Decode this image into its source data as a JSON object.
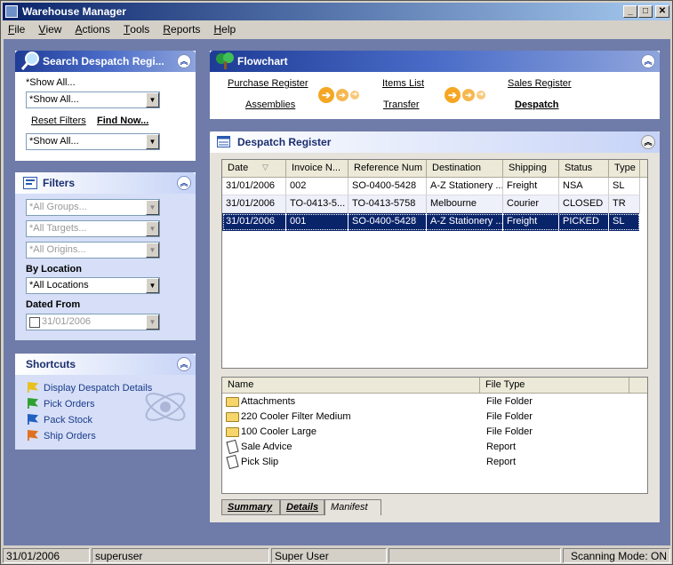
{
  "window": {
    "title": "Warehouse Manager"
  },
  "menu": [
    {
      "label": "File",
      "mnemonic": "F",
      "rest": "ile"
    },
    {
      "label": "View",
      "mnemonic": "V",
      "rest": "iew"
    },
    {
      "label": "Actions",
      "mnemonic": "A",
      "rest": "ctions"
    },
    {
      "label": "Tools",
      "mnemonic": "T",
      "rest": "ools"
    },
    {
      "label": "Reports",
      "mnemonic": "R",
      "rest": "eports"
    },
    {
      "label": "Help",
      "mnemonic": "H",
      "rest": "elp"
    }
  ],
  "search_panel": {
    "title": "Search Despatch Regi...",
    "heading": "*Show All...",
    "combo1": "*Show All...",
    "reset_label": "Reset Filters",
    "find_label": "Find Now...",
    "combo2": "*Show All..."
  },
  "filters_panel": {
    "title": "Filters",
    "groups": "*All Groups...",
    "targets": "*All Targets...",
    "origins": "*All Origins...",
    "by_location_label": "By Location",
    "location": "*All Locations",
    "dated_from_label": "Dated From",
    "dated_from": "31/01/2006"
  },
  "shortcuts_panel": {
    "title": "Shortcuts",
    "items": [
      {
        "label": "Display Despatch Details",
        "color": "#e8c020"
      },
      {
        "label": "Pick Orders",
        "color": "#30a030"
      },
      {
        "label": "Pack Stock",
        "color": "#2060c0"
      },
      {
        "label": "Ship Orders",
        "color": "#e07020"
      }
    ]
  },
  "flowchart": {
    "title": "Flowchart",
    "purchase_register": "Purchase Register",
    "assemblies": "Assemblies",
    "items_list": "Items List",
    "transfer": "Transfer",
    "sales_register": "Sales Register",
    "despatch": "Despatch"
  },
  "register": {
    "title": "Despatch Register",
    "columns": [
      "Date",
      "Invoice N...",
      "Reference Num",
      "Destination",
      "Shipping",
      "Status",
      "Type"
    ],
    "rows": [
      [
        "31/01/2006",
        "002",
        "SO-0400-5428",
        "A-Z Stationery ...",
        "Freight",
        "NSA",
        "SL"
      ],
      [
        "31/01/2006",
        "TO-0413-5...",
        "TO-0413-5758",
        "Melbourne",
        "Courier",
        "CLOSED",
        "TR"
      ],
      [
        "31/01/2006",
        "001",
        "SO-0400-5428",
        "A-Z Stationery ...",
        "Freight",
        "PICKED",
        "SL"
      ]
    ],
    "selected_row": 2
  },
  "files": {
    "columns": [
      "Name",
      "File Type"
    ],
    "rows": [
      {
        "name": "Attachments",
        "type": "File Folder",
        "icon": "folder-icon"
      },
      {
        "name": "220 Cooler Filter Medium",
        "type": "File Folder",
        "icon": "folder-icon"
      },
      {
        "name": "100 Cooler Large",
        "type": "File Folder",
        "icon": "folder-icon"
      },
      {
        "name": "Sale Advice",
        "type": "Report",
        "icon": "document-icon"
      },
      {
        "name": "Pick Slip",
        "type": "Report",
        "icon": "document-icon"
      }
    ]
  },
  "tabs": [
    "Summary",
    "Details",
    "Manifest"
  ],
  "active_tab": "Manifest",
  "status": {
    "date": "31/01/2006",
    "user": "superuser",
    "role": "Super User",
    "extra": "",
    "scanning": "Scanning Mode: ON"
  },
  "colors": {
    "selection": "#0a246a",
    "panel_blue": "#1e3c96",
    "workspace": "#6f7ba8",
    "accent_arrow": "#f5a623"
  }
}
